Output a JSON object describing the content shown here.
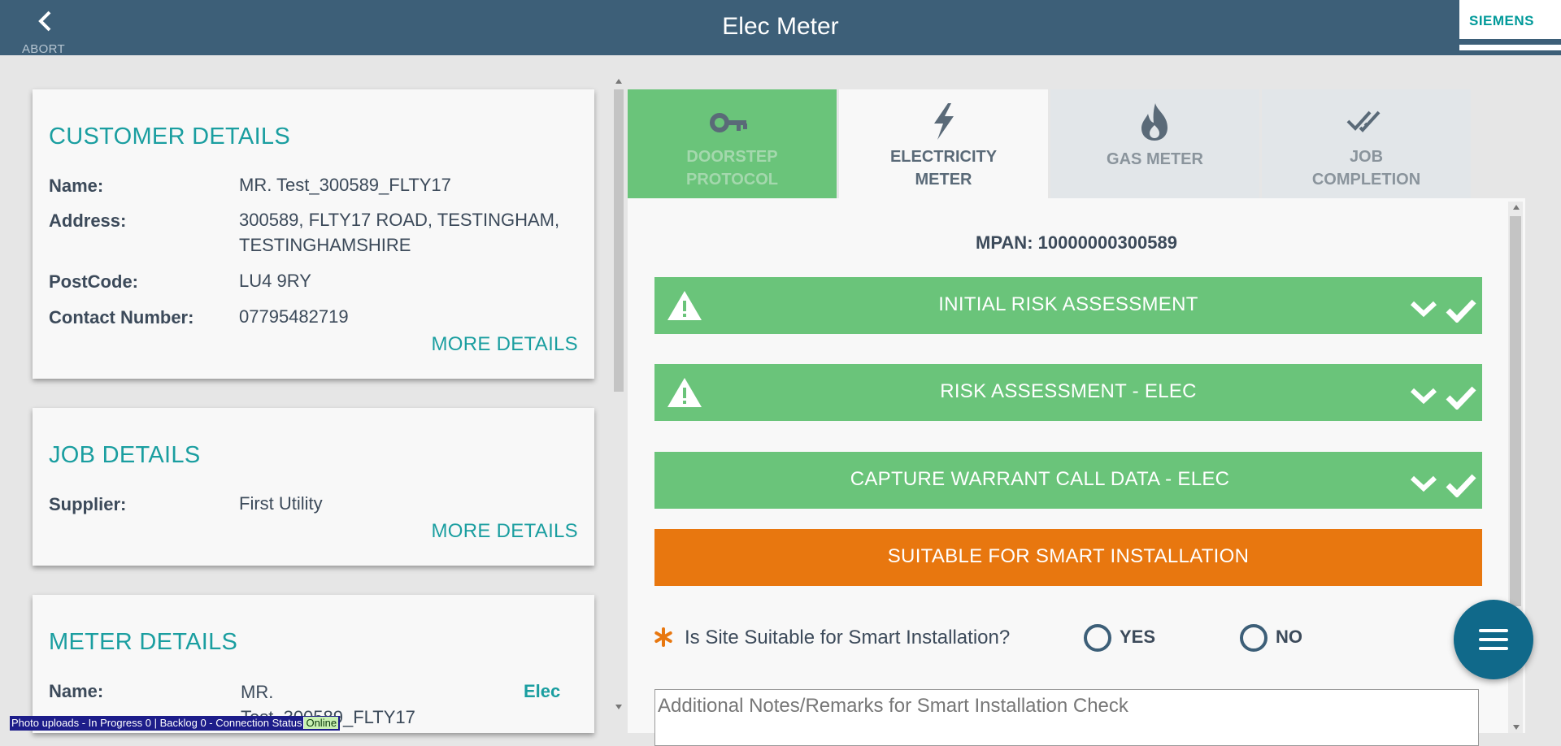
{
  "header": {
    "abort_label": "ABORT",
    "title": "Elec Meter",
    "logo_text": "SIEMENS"
  },
  "customer_details": {
    "title": "CUSTOMER DETAILS",
    "fields": [
      {
        "label": "Name:",
        "value": "MR. Test_300589_FLTY17"
      },
      {
        "label": "Address:",
        "value": "300589, FLTY17 ROAD, TESTINGHAM, TESTINGHAMSHIRE"
      },
      {
        "label": "PostCode:",
        "value": "LU4 9RY"
      },
      {
        "label": "Contact Number:",
        "value": "07795482719"
      }
    ],
    "more_label": "MORE DETAILS"
  },
  "job_details": {
    "title": "JOB DETAILS",
    "fields": [
      {
        "label": "Supplier:",
        "value": "First Utility"
      }
    ],
    "more_label": "MORE DETAILS"
  },
  "meter_details": {
    "title": "METER DETAILS",
    "fields": [
      {
        "label": "Name:",
        "value": "MR. Test_300589_FLTY17",
        "type": "Elec"
      }
    ]
  },
  "tabs": [
    {
      "label": "DOORSTEP\nPROTOCOL",
      "icon": "key-icon",
      "state": "completed"
    },
    {
      "label": "ELECTRICITY\nMETER",
      "icon": "lightning-icon",
      "state": "active"
    },
    {
      "label": "GAS METER",
      "icon": "flame-icon",
      "state": "inactive"
    },
    {
      "label": "JOB\nCOMPLETION",
      "icon": "double-check-icon",
      "state": "inactive"
    }
  ],
  "main": {
    "mpan": "MPAN: 10000000300589",
    "sections": [
      {
        "label": "INITIAL RISK ASSESSMENT",
        "status": "complete",
        "warning_icon": true
      },
      {
        "label": "RISK ASSESSMENT - ELEC",
        "status": "complete",
        "warning_icon": true
      },
      {
        "label": "CAPTURE WARRANT CALL DATA - ELEC",
        "status": "complete",
        "warning_icon": false
      },
      {
        "label": "SUITABLE FOR SMART INSTALLATION",
        "status": "in-progress",
        "warning_icon": false
      }
    ],
    "question": "Is Site Suitable for Smart Installation?",
    "options": [
      "YES",
      "NO"
    ],
    "notes_placeholder": "Additional Notes/Remarks for Smart Installation Check",
    "notes_value": ""
  },
  "status_bar": {
    "text": "Photo uploads - In Progress 0 | Backlog 0 - Connection Status",
    "connection": "Online"
  },
  "colors": {
    "header": "#3d5f78",
    "accent_teal": "#1a9ea0",
    "complete_green": "#6ac47a",
    "in_progress_orange": "#e8770f",
    "fab": "#10698a"
  }
}
